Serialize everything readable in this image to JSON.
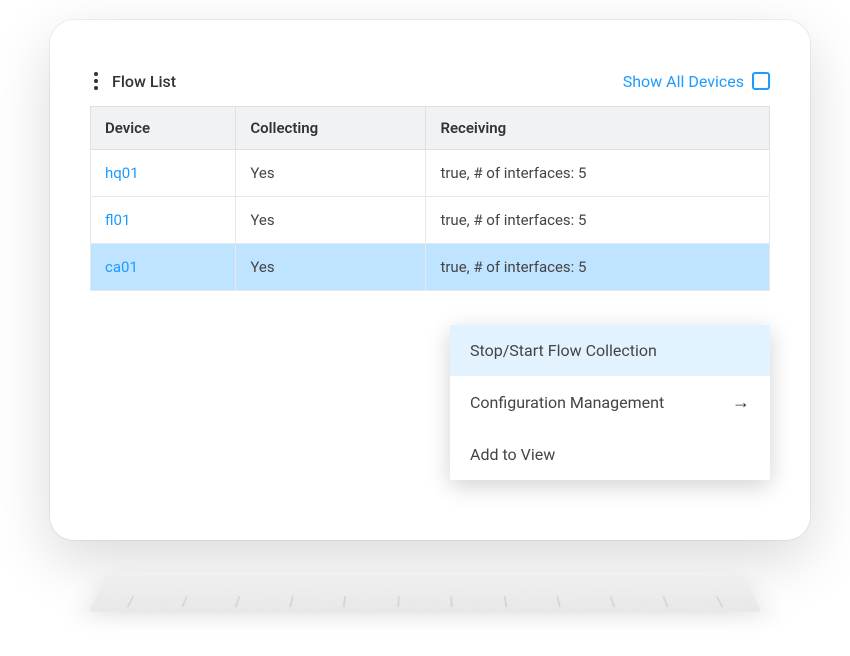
{
  "panel": {
    "title": "Flow List",
    "show_all_label": "Show All Devices"
  },
  "table": {
    "headers": {
      "device": "Device",
      "collecting": "Collecting",
      "receiving": "Receiving"
    },
    "rows": [
      {
        "device": "hq01",
        "collecting": "Yes",
        "receiving": "true, # of interfaces: 5",
        "selected": false
      },
      {
        "device": "fl01",
        "collecting": "Yes",
        "receiving": "true, # of interfaces: 5",
        "selected": false
      },
      {
        "device": "ca01",
        "collecting": "Yes",
        "receiving": "true, # of interfaces: 5",
        "selected": true
      }
    ]
  },
  "context_menu": {
    "items": [
      {
        "label": "Stop/Start Flow Collection",
        "highlighted": true,
        "has_submenu": false
      },
      {
        "label": "Configuration Management",
        "highlighted": false,
        "has_submenu": true
      },
      {
        "label": "Add to View",
        "highlighted": false,
        "has_submenu": false
      }
    ]
  },
  "colors": {
    "accent": "#1e9bff",
    "row_selected": "#bfe4ff",
    "menu_highlight": "#e3f2ff"
  }
}
